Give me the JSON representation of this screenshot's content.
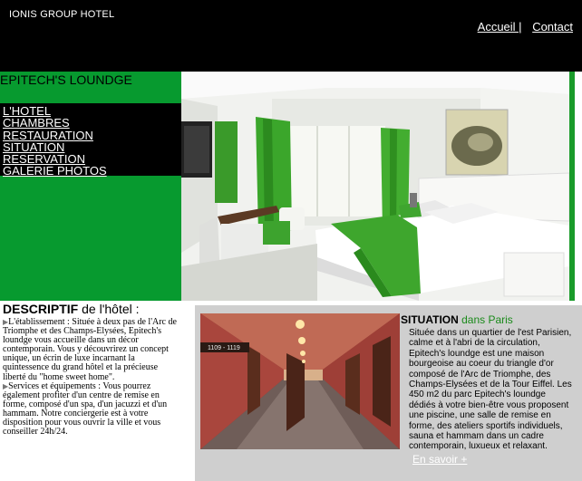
{
  "header": {
    "site_title": "IONIS GROUP HOTEL",
    "nav": [
      {
        "label": "Accueil |"
      },
      {
        "label": "Contact"
      }
    ]
  },
  "sidebar": {
    "hotel_name": "EPITECH'S LOUNDGE",
    "menu": [
      {
        "label": "L'HOTEL"
      },
      {
        "label": "CHAMBRES"
      },
      {
        "label": "RESTAURATION"
      },
      {
        "label": "SITUATION"
      },
      {
        "label": "RESERVATION"
      },
      {
        "label": "GALERIE PHOTOS"
      }
    ]
  },
  "descriptif": {
    "title_bold": "DESCRIPTIF",
    "title_rest": " de l'hôtel :",
    "items": [
      "L'établissement : Située à deux pas de l'Arc de Triomphe et des Champs-Elysées, Epitech's loundge vous accueille dans un décor contemporain. Vous y découvrirez un concept unique, un écrin de luxe incarnant la quintessence du grand hôtel et la précieuse liberté du \"home sweet home\".",
      "Services et équipements : Vous pourrez également profiter d'un centre de remise en forme, composé d'un spa, d'un jacuzzi et d'un hammam. Notre conciergerie est à votre disposition pour vous ouvrir la ville et vous conseiller 24h/24."
    ]
  },
  "situation": {
    "title_bold": "SITUATION",
    "title_rest": " dans Paris",
    "text": "Située dans un quartier de l'est Parisien, calme et à l'abri de la circulation, Epitech's loundge est une maison bourgeoise au coeur du triangle d'or composé de l'Arc de Triomphe, des Champs-Elysées et de la Tour Eiffel. Les 450 m2 du parc Epitech's loundge dédiés à votre bien-être vous proposent une piscine, une salle de remise en forme, des ateliers sportifs individuels, sauna et hammam dans un cadre contemporain, luxueux et relaxant.",
    "more_link": "En savoir +",
    "room_sign": "1109 - 1119"
  },
  "colors": {
    "green": "#079a2f",
    "black": "#000000",
    "gray_panel": "#cfcfcf"
  }
}
